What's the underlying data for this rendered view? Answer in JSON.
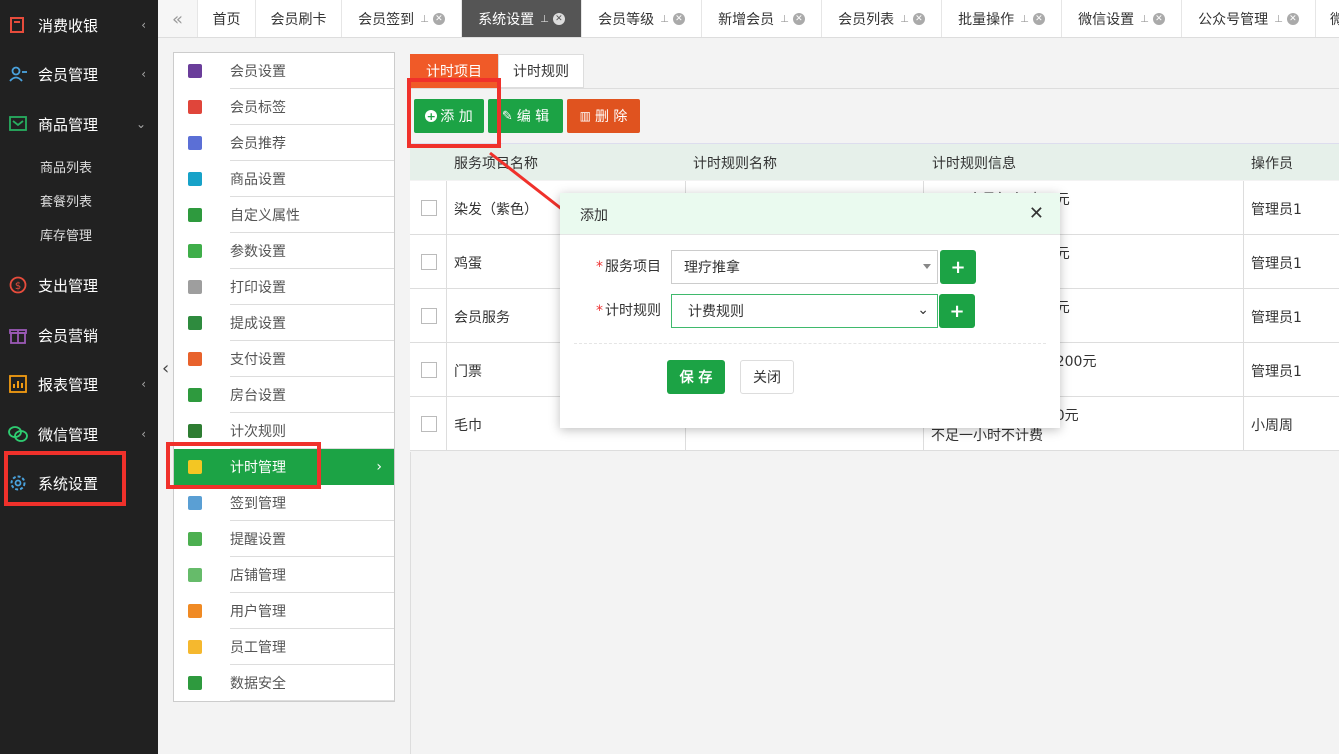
{
  "sidebar": {
    "items": [
      {
        "label": "消费收银",
        "icon": "cash-register-icon",
        "chevron": "‹"
      },
      {
        "label": "会员管理",
        "icon": "members-icon",
        "chevron": "‹"
      },
      {
        "label": "商品管理",
        "icon": "goods-icon",
        "chevron": "⌄"
      },
      {
        "label": "支出管理",
        "icon": "expense-icon",
        "chevron": ""
      },
      {
        "label": "会员营销",
        "icon": "gift-icon",
        "chevron": ""
      },
      {
        "label": "报表管理",
        "icon": "report-icon",
        "chevron": "‹"
      },
      {
        "label": "微信管理",
        "icon": "wechat-icon",
        "chevron": "‹"
      },
      {
        "label": "系统设置",
        "icon": "gear-icon",
        "chevron": ""
      }
    ],
    "sub_items": [
      "商品列表",
      "套餐列表",
      "库存管理"
    ]
  },
  "tabs": {
    "back": "«",
    "items": [
      {
        "label": "首页"
      },
      {
        "label": "会员刷卡"
      },
      {
        "label": "会员签到"
      },
      {
        "label": "系统设置"
      },
      {
        "label": "会员等级"
      },
      {
        "label": "新增会员"
      },
      {
        "label": "会员列表"
      },
      {
        "label": "批量操作"
      },
      {
        "label": "微信设置"
      },
      {
        "label": "公众号管理"
      },
      {
        "label": "微"
      }
    ]
  },
  "settings_menu": {
    "items": [
      {
        "label": "会员设置",
        "color": "#6a3d9a"
      },
      {
        "label": "会员标签",
        "color": "#e0453a"
      },
      {
        "label": "会员推荐",
        "color": "#5b6fd6"
      },
      {
        "label": "商品设置",
        "color": "#17a2c8"
      },
      {
        "label": "自定义属性",
        "color": "#2e9a3e"
      },
      {
        "label": "参数设置",
        "color": "#3fae4a"
      },
      {
        "label": "打印设置",
        "color": "#9e9e9e"
      },
      {
        "label": "提成设置",
        "color": "#2e8b3e"
      },
      {
        "label": "支付设置",
        "color": "#e8622c"
      },
      {
        "label": "房台设置",
        "color": "#2e9a3e"
      },
      {
        "label": "计次规则",
        "color": "#2e7d32"
      },
      {
        "label": "计时管理",
        "color": "#f3c623"
      },
      {
        "label": "签到管理",
        "color": "#5a9fd4"
      },
      {
        "label": "提醒设置",
        "color": "#4caf50"
      },
      {
        "label": "店铺管理",
        "color": "#66bb6a"
      },
      {
        "label": "用户管理",
        "color": "#f08a24"
      },
      {
        "label": "员工管理",
        "color": "#f5b82e"
      },
      {
        "label": "数据安全",
        "color": "#2e9a3e"
      }
    ],
    "active_arrow": "›",
    "collapse": "‹"
  },
  "content": {
    "tabs": [
      "计时项目",
      "计时规则"
    ],
    "buttons": {
      "add": "添 加",
      "edit": "编 辑",
      "delete": "删 除"
    },
    "table": {
      "headers": [
        "服务项目名称",
        "计时规则名称",
        "计时规则信息",
        "操作员"
      ],
      "rows": [
        {
          "name": "染发（紫色）",
          "rule": "",
          "info": "0元，会员每小时60元",
          "info2": "",
          "op": "管理员1"
        },
        {
          "name": "鸡蛋",
          "rule": "",
          "info": "0元，会员每小时60元",
          "info2": "",
          "op": "管理员1"
        },
        {
          "name": "会员服务",
          "rule": "",
          "info": "0元，会员每小时40元",
          "info2": "",
          "op": "管理员1"
        },
        {
          "name": "门票",
          "rule": "",
          "info": "000元，会员每小时200元",
          "info2": "",
          "op": "管理员1"
        },
        {
          "name": "毛巾",
          "rule": "",
          "info": "50元，会员每小时60元",
          "info2": "不足一小时不计费",
          "op": "小周周"
        }
      ]
    }
  },
  "modal": {
    "title": "添加",
    "close": "✕",
    "fields": [
      {
        "required": "*",
        "label": "服务项目",
        "value": "理疗推拿"
      },
      {
        "required": "*",
        "label": "计时规则",
        "value": "计费规则"
      }
    ],
    "plus": "+",
    "save": "保 存",
    "cancel": "关闭"
  },
  "colors": {
    "accent": "#1ca345",
    "active_tab": "#f05a28",
    "delete": "#e0531f",
    "annotation": "#f0312b"
  }
}
